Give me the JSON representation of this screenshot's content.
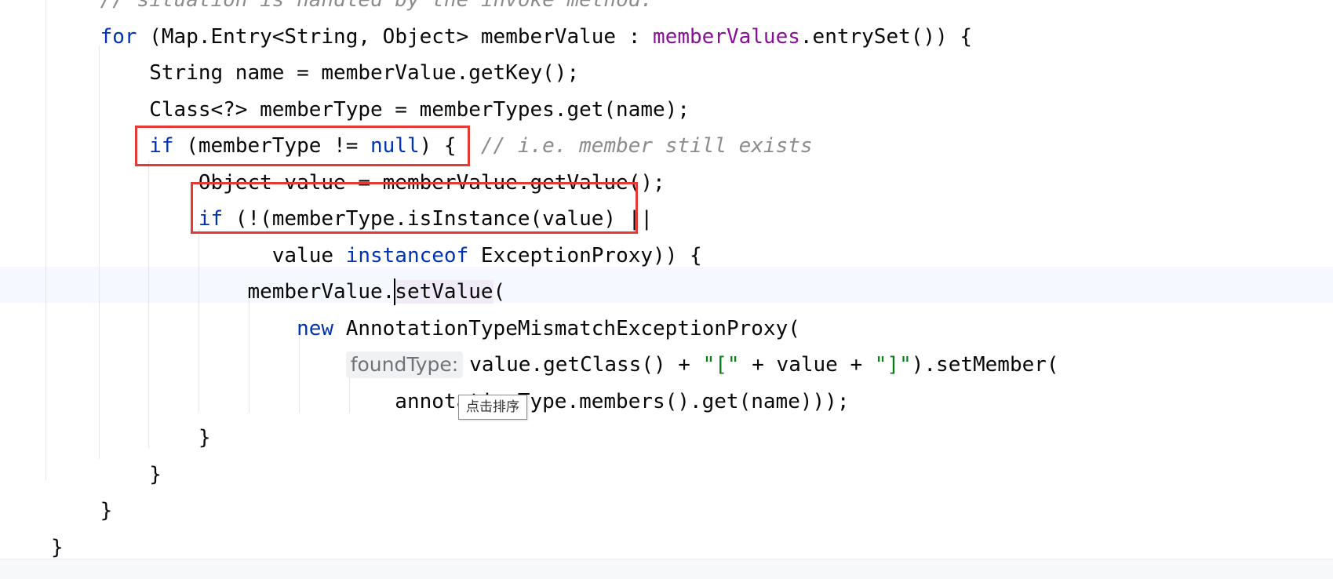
{
  "editor": {
    "lines": [
      {
        "indent": "    ",
        "parts": [
          {
            "t": "// situation is handled by the invoke method.",
            "c": "comment"
          }
        ]
      },
      {
        "indent": "    ",
        "parts": [
          {
            "t": "for",
            "c": "kw"
          },
          {
            "t": " (Map.Entry<String, Object> memberValue : ",
            "c": "plain"
          },
          {
            "t": "memberValues",
            "c": "field"
          },
          {
            "t": ".entrySet()) {",
            "c": "plain"
          }
        ]
      },
      {
        "indent": "        ",
        "parts": [
          {
            "t": "String name = memberValue.getKey();",
            "c": "plain"
          }
        ]
      },
      {
        "indent": "        ",
        "parts": [
          {
            "t": "Class<?> memberType = memberTypes.get(name);",
            "c": "plain"
          }
        ]
      },
      {
        "indent": "        ",
        "parts": [
          {
            "t": "if",
            "c": "kw"
          },
          {
            "t": " (memberType != ",
            "c": "plain"
          },
          {
            "t": "null",
            "c": "kw"
          },
          {
            "t": ") {  ",
            "c": "plain"
          },
          {
            "t": "// i.e. member still exists",
            "c": "comment"
          }
        ]
      },
      {
        "indent": "            ",
        "parts": [
          {
            "t": "Object value = memberValue.getValue();",
            "c": "plain"
          }
        ]
      },
      {
        "indent": "            ",
        "parts": [
          {
            "t": "if",
            "c": "kw"
          },
          {
            "t": " (!(memberType.isInstance(value) ||",
            "c": "plain"
          }
        ]
      },
      {
        "indent": "                  ",
        "parts": [
          {
            "t": "value ",
            "c": "plain"
          },
          {
            "t": "instanceof",
            "c": "kw"
          },
          {
            "t": " ExceptionProxy)) {",
            "c": "plain"
          }
        ]
      },
      {
        "indent": "                ",
        "parts": [
          {
            "t": "memberValue.",
            "c": "plain"
          },
          {
            "t": "|caret|",
            "c": "caret"
          },
          {
            "t": "setValue",
            "c": "hl"
          },
          {
            "t": "(",
            "c": "plain"
          }
        ]
      },
      {
        "indent": "                    ",
        "parts": [
          {
            "t": "new",
            "c": "kw"
          },
          {
            "t": " AnnotationTypeMismatchExceptionProxy(",
            "c": "plain"
          }
        ]
      },
      {
        "indent": "                        ",
        "parts": [
          {
            "t": "foundType:",
            "c": "inlay"
          },
          {
            "t": "value.getClass() + ",
            "c": "plain"
          },
          {
            "t": "\"[\"",
            "c": "str"
          },
          {
            "t": " + value + ",
            "c": "plain"
          },
          {
            "t": "\"]\"",
            "c": "str"
          },
          {
            "t": ").setMember(",
            "c": "plain"
          }
        ]
      },
      {
        "indent": "                            ",
        "parts": [
          {
            "t": "annotationType.members().get(name)));",
            "c": "plain"
          }
        ]
      },
      {
        "indent": "            ",
        "parts": [
          {
            "t": "}",
            "c": "plain"
          }
        ]
      },
      {
        "indent": "        ",
        "parts": [
          {
            "t": "}",
            "c": "plain"
          }
        ]
      },
      {
        "indent": "    ",
        "parts": [
          {
            "t": "}",
            "c": "plain"
          }
        ]
      },
      {
        "indent": "",
        "parts": [
          {
            "t": "}",
            "c": "plain"
          }
        ]
      }
    ]
  },
  "tooltip": {
    "text": "点击排序"
  },
  "colors": {
    "keyword": "#0033b3",
    "field": "#871094",
    "string": "#067d17",
    "comment": "#8c8c8c",
    "text": "#080808",
    "annotation_box": "#e53935",
    "current_line": "#f5f8fe"
  }
}
